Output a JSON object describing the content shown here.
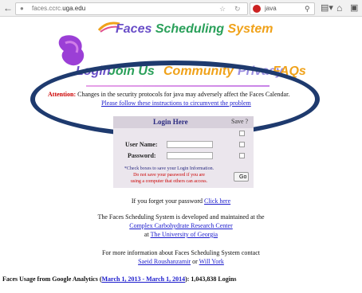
{
  "browser": {
    "url_prefix": "faces.ccrc.",
    "url_domain": "uga.edu",
    "search_text": "java",
    "icons": [
      "back-arrow-icon",
      "site-identity-icon",
      "bookmark-star-icon",
      "reload-icon",
      "search-engine-icon",
      "search-icon",
      "bookmarks-menu-icon",
      "home-icon",
      "extension-icon"
    ]
  },
  "header": {
    "title_word1": "Faces",
    "title_word2": "Scheduling",
    "title_word3": "System"
  },
  "nav": {
    "login": "Login",
    "join": "Join Us",
    "community": "Community",
    "privacy": "Privacy",
    "faqs": "FAQs"
  },
  "attention": {
    "label": "Attention:",
    "message": " Changes in the security protocols for java may adversely affect the Faces Calendar.",
    "link": "Please follow these instructions to circumvent the problem"
  },
  "login": {
    "title": "Login Here",
    "save_label": "Save ?",
    "username_label": "User Name:",
    "password_label": "Password:",
    "username_value": "",
    "password_value": "",
    "note_line1": "*Check boxes to save your Login Information.",
    "note_line2": "Do not save your password if you are",
    "note_line3": "using a computer that others can access.",
    "go_label": "Go"
  },
  "forgot": {
    "text": "If you forget your password ",
    "link": "Click here"
  },
  "developed": {
    "line1": "The Faces Scheduling System is developed and maintained at the",
    "line2_link": "Complex Carbohydrate Research Center",
    "line3_prefix": "at ",
    "line3_link": "The University of Georgia"
  },
  "contact": {
    "line1": "For more information about Faces Scheduling System contact",
    "person1": "Saeid Roushanzamir",
    "or": " or ",
    "person2": "Will York"
  },
  "usage": {
    "prefix": "Faces Usage from Google Analytics (",
    "range_link": "March 1, 2013 - March 1, 2014",
    "suffix": "): 1,043,838 Logins"
  },
  "colors": {
    "faces": "#6a4fc8",
    "scheduling": "#2aa05a",
    "system": "#f0a21a",
    "attention": "#cc0000",
    "link": "#1a1acc",
    "annotation": "#1e3a6e"
  }
}
